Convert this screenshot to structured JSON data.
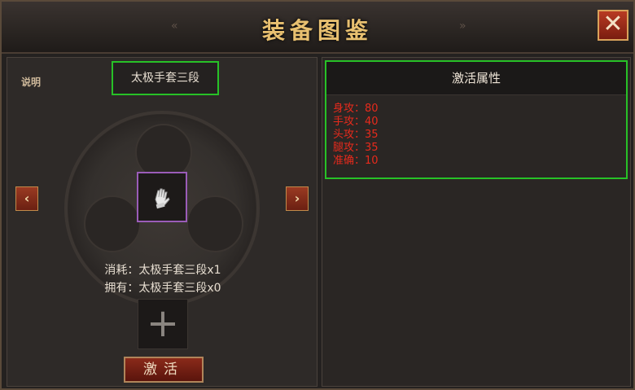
{
  "window": {
    "title": "装备图鉴",
    "close_label": "✕"
  },
  "left": {
    "help_label": "说明",
    "item_name": "太极手套三段",
    "prev_arrow": "‹",
    "next_arrow": "›",
    "consume_line": "消耗：太极手套三段x1",
    "owned_line": "拥有：太极手套三段x0",
    "add_label": "+",
    "activate_label": "激活"
  },
  "right": {
    "header": "激活属性",
    "attributes": [
      "身攻：80",
      "手攻：40",
      "头攻：35",
      "腿攻：35",
      "准确：10"
    ]
  },
  "colors": {
    "attribute_text": "#e82a1c",
    "highlight_border": "#27c127",
    "item_slot_border": "#9a5cb8"
  },
  "icons": {
    "help": "help-emblem-icon",
    "item": "glove-icon",
    "close": "close-icon"
  }
}
